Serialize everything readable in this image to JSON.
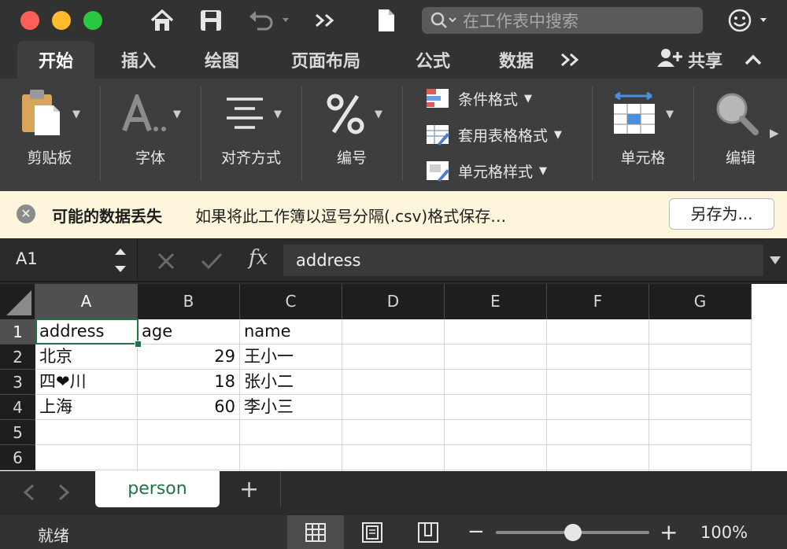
{
  "search": {
    "placeholder": "在工作表中搜索"
  },
  "tabs": [
    {
      "label": "开始",
      "active": true
    },
    {
      "label": "插入"
    },
    {
      "label": "绘图"
    },
    {
      "label": "页面布局"
    },
    {
      "label": "公式"
    },
    {
      "label": "数据"
    }
  ],
  "share_label": "共享",
  "ribbon": {
    "paste": "剪贴板",
    "font": "字体",
    "align": "对齐方式",
    "number": "编号",
    "cond_format": "条件格式",
    "table_format": "套用表格格式",
    "cell_style": "单元格样式",
    "cells": "单元格",
    "edit": "编辑"
  },
  "message": {
    "title": "可能的数据丢失",
    "text": "如果将此工作簿以逗号分隔(.csv)格式保存…",
    "button": "另存为..."
  },
  "formula": {
    "name_box": "A1",
    "value": "address",
    "fx": "fx"
  },
  "grid": {
    "columns": [
      "A",
      "B",
      "C",
      "D",
      "E",
      "F",
      "G"
    ],
    "rows": [
      "1",
      "2",
      "3",
      "4",
      "5",
      "6"
    ],
    "cells": [
      [
        "address",
        "age",
        "name"
      ],
      [
        "北京",
        "29",
        "王小一"
      ],
      [
        "四❤川",
        "18",
        "张小二"
      ],
      [
        "上海",
        "60",
        "李小三"
      ]
    ]
  },
  "sheet": {
    "name": "person",
    "add": "+"
  },
  "status": {
    "text": "就绪",
    "zoom_label": "100%",
    "zoom_fraction": 0.5,
    "minus": "−",
    "plus": "+"
  },
  "colors": {
    "accent": "#217346",
    "close": "#fe5f57",
    "minimize": "#febc2e",
    "maximize": "#28c840",
    "message_bg": "#fdf6dc"
  }
}
